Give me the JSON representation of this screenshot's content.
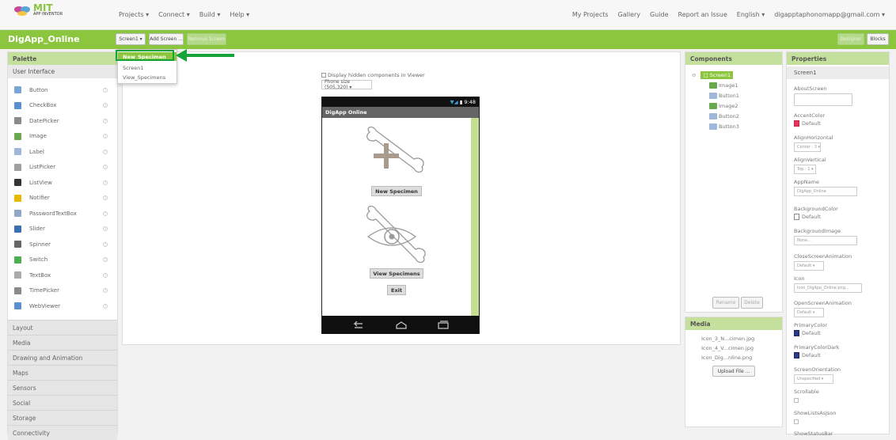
{
  "topbar": {
    "logo_main": "MIT",
    "logo_sub": "APP INVENTOR",
    "nav": [
      "Projects ▾",
      "Connect ▾",
      "Build ▾",
      "Help ▾"
    ],
    "right": [
      "My Projects",
      "Gallery",
      "Guide",
      "Report an Issue",
      "English ▾",
      "digapptaphonomapp@gmail.com ▾"
    ]
  },
  "project": {
    "name": "DigApp_Online",
    "screen_select": "Screen1 ▾",
    "add_screen": "Add Screen ...",
    "remove_screen": "Remove Screen",
    "designer": "Designer",
    "blocks": "Blocks"
  },
  "dropdown": {
    "items": [
      "New_Specimen",
      "Screen1",
      "View_Specimens"
    ]
  },
  "palette": {
    "title": "Palette",
    "category": "User Interface",
    "items": [
      {
        "label": "Button",
        "icon": "button-icon",
        "color": "#7aa6d6"
      },
      {
        "label": "CheckBox",
        "icon": "checkbox-icon",
        "color": "#5a8fd0"
      },
      {
        "label": "DatePicker",
        "icon": "datepicker-icon",
        "color": "#8a8a8a"
      },
      {
        "label": "Image",
        "icon": "image-icon",
        "color": "#6aa84f"
      },
      {
        "label": "Label",
        "icon": "label-icon",
        "color": "#9fb7d8"
      },
      {
        "label": "ListPicker",
        "icon": "listpicker-icon",
        "color": "#a0a0a0"
      },
      {
        "label": "ListView",
        "icon": "listview-icon",
        "color": "#333333"
      },
      {
        "label": "Notifier",
        "icon": "notifier-icon",
        "color": "#e6b800"
      },
      {
        "label": "PasswordTextBox",
        "icon": "password-icon",
        "color": "#8fa9c7"
      },
      {
        "label": "Slider",
        "icon": "slider-icon",
        "color": "#3a6fb0"
      },
      {
        "label": "Spinner",
        "icon": "spinner-icon",
        "color": "#666666"
      },
      {
        "label": "Switch",
        "icon": "switch-icon",
        "color": "#4caf50"
      },
      {
        "label": "TextBox",
        "icon": "textbox-icon",
        "color": "#aaaaaa"
      },
      {
        "label": "TimePicker",
        "icon": "timepicker-icon",
        "color": "#8a8a8a"
      },
      {
        "label": "WebViewer",
        "icon": "webviewer-icon",
        "color": "#5a8fd0"
      }
    ],
    "categories": [
      "Layout",
      "Media",
      "Drawing and Animation",
      "Maps",
      "Sensors",
      "Social",
      "Storage",
      "Connectivity"
    ]
  },
  "viewer": {
    "checkbox_label": "Display hidden components in Viewer",
    "phone_size": "Phone size (505,320) ▾",
    "status_time": "9:48",
    "app_title": "DigApp Online",
    "btn_new": "New Specimen",
    "btn_view": "View Specimens",
    "btn_exit": "Exit"
  },
  "components": {
    "title": "Components",
    "root": "Screen1",
    "children": [
      "Image1",
      "Button1",
      "Image2",
      "Button2",
      "Button3"
    ],
    "rename": "Rename",
    "delete": "Delete"
  },
  "media": {
    "title": "Media",
    "files": [
      "Icon_3_N...cimen.jpg",
      "Icon_4_V...cimen.jpg",
      "Icon_Dig...nline.png"
    ],
    "upload": "Upload File ..."
  },
  "properties": {
    "title": "Properties",
    "screen": "Screen1",
    "about_screen": "AboutScreen",
    "accent_color": "AccentColor",
    "accent_val": "Default",
    "align_h": "AlignHorizontal",
    "align_h_val": "Center : 3 ▾",
    "align_v": "AlignVertical",
    "align_v_val": "Top : 1 ▾",
    "app_name": "AppName",
    "app_name_val": "DigApp_Online",
    "bg_color": "BackgroundColor",
    "bg_color_val": "Default",
    "bg_image": "BackgroundImage",
    "bg_image_val": "None...",
    "close_anim": "CloseScreenAnimation",
    "close_anim_val": "Default ▾",
    "icon": "Icon",
    "icon_val": "Icon_DigApp_Online.png...",
    "open_anim": "OpenScreenAnimation",
    "open_anim_val": "Default ▾",
    "primary_color": "PrimaryColor",
    "primary_color_val": "Default",
    "primary_dark": "PrimaryColorDark",
    "primary_dark_val": "Default",
    "orientation": "ScreenOrientation",
    "orientation_val": "Unspecified ▾",
    "scrollable": "Scrollable",
    "show_lists": "ShowListsAsJson",
    "show_status": "ShowStatusBar"
  },
  "colors": {
    "brand_green": "#8cc63f",
    "accent_pink": "#e8345a",
    "primary_navy": "#2b3a8c",
    "annotation_green": "#16a33a"
  }
}
